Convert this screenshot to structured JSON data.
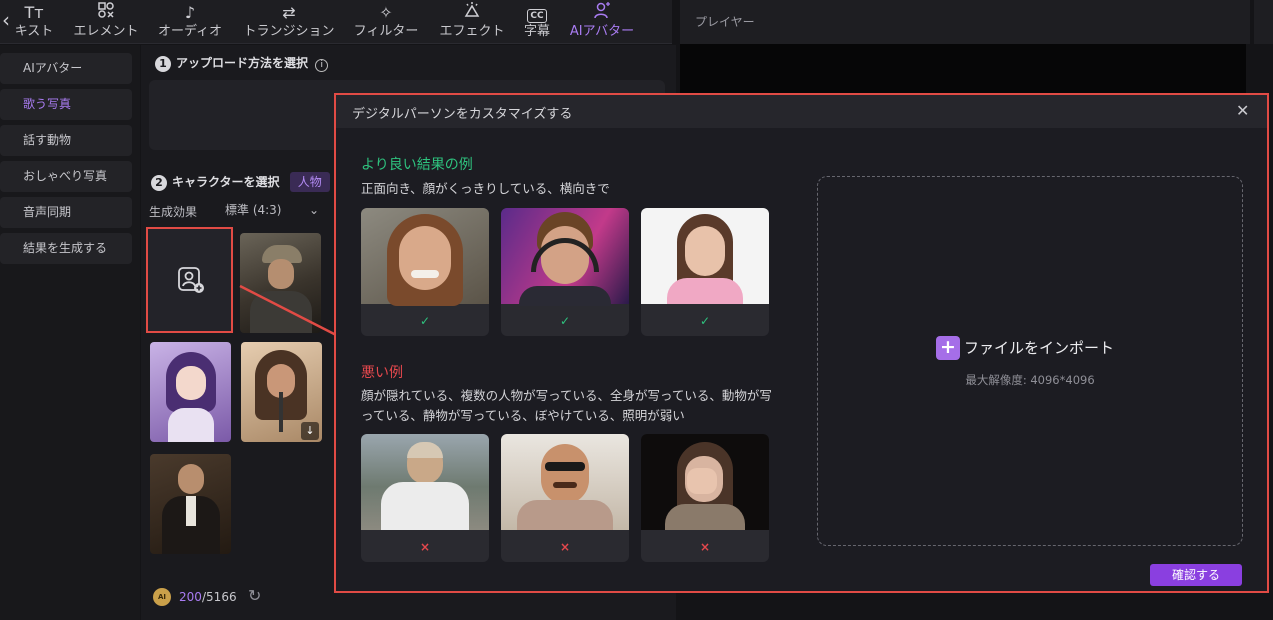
{
  "toolbar": {
    "tabs": [
      {
        "label": "キスト",
        "icon": "text-icon"
      },
      {
        "label": "エレメント",
        "icon": "elements-icon"
      },
      {
        "label": "オーディオ",
        "icon": "music-note-icon"
      },
      {
        "label": "トランジション",
        "icon": "transition-arrows-icon"
      },
      {
        "label": "フィルター",
        "icon": "sparkle-icon"
      },
      {
        "label": "エフェクト",
        "icon": "effect-icon"
      },
      {
        "label": "字幕",
        "icon": "cc-icon"
      },
      {
        "label": "AIアバター",
        "icon": "avatar-icon"
      }
    ],
    "text_glyph": "Tт",
    "cc_glyph": "CC",
    "accent": "#a97cf2"
  },
  "player": {
    "title": "プレイヤー"
  },
  "sidebar": {
    "items": [
      "AIアバター",
      "歌う写真",
      "話す動物",
      "おしゃべり写真",
      "音声同期",
      "結果を生成する"
    ],
    "active_index": 1
  },
  "mid_panel": {
    "step1": {
      "num": "1",
      "title": "アップロード方法を選択"
    },
    "step2": {
      "num": "2",
      "title": "キャラクターを選択",
      "tag": "人物"
    },
    "effect_label": "生成効果",
    "effect_select": "標準 (4:3)",
    "credits": {
      "used": "200",
      "total": "/5166",
      "badge": "AI"
    }
  },
  "modal": {
    "title": "デジタルパーソンをカスタマイズする",
    "good": {
      "title": "より良い結果の例",
      "desc": "正面向き、顔がくっきりしている、横向きで",
      "mark": "✓",
      "color": "#2ec27e"
    },
    "bad": {
      "title": "悪い例",
      "desc": "顔が隠れている、複数の人物が写っている、全身が写っている、動物が写っている、静物が写っている、ぼやけている、照明が弱い",
      "mark": "×",
      "color": "#e5484d"
    },
    "import": {
      "label": "ファイルをインポート",
      "hint": "最大解像度: 4096*4096"
    },
    "confirm_label": "確認する"
  }
}
